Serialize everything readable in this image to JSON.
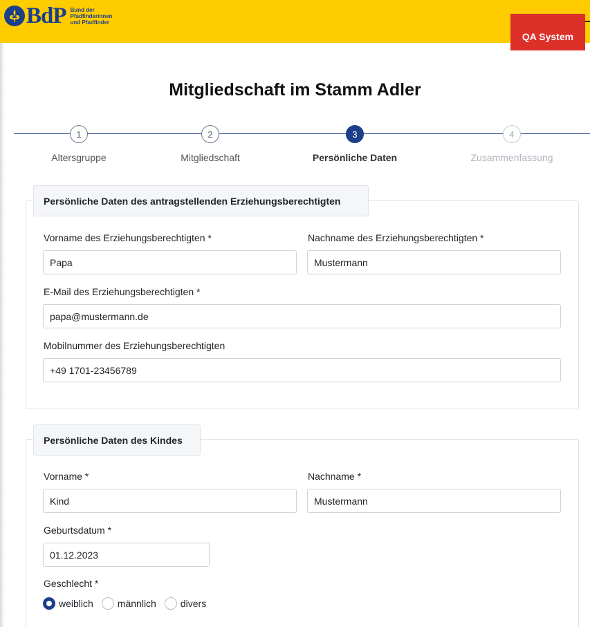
{
  "header": {
    "logo_name": "BdP",
    "logo_sub_lines": [
      "Bund der",
      "Pfadfinderinnen",
      "und Pfadfinder"
    ],
    "badge": "QA System",
    "brand_color": "#ffcc00",
    "accent_color": "#1c3f8a",
    "badge_color": "#dc3028"
  },
  "page": {
    "title": "Mitgliedschaft im Stamm Adler"
  },
  "stepper": {
    "current_step": 3,
    "steps": [
      {
        "number": "1",
        "label": "Altersgruppe",
        "state": "done"
      },
      {
        "number": "2",
        "label": "Mitgliedschaft",
        "state": "done"
      },
      {
        "number": "3",
        "label": "Persönliche Daten",
        "state": "active"
      },
      {
        "number": "4",
        "label": "Zusammenfassung",
        "state": "pending"
      }
    ]
  },
  "guardian": {
    "legend": "Persönliche Daten des antragstellenden Erziehungsberechtigten",
    "firstname_label": "Vorname des Erziehungsberechtigten *",
    "firstname_value": "Papa",
    "lastname_label": "Nachname des Erziehungsberechtigten *",
    "lastname_value": "Mustermann",
    "email_label": "E-Mail des Erziehungsberechtigten *",
    "email_value": "papa@mustermann.de",
    "mobile_label": "Mobilnummer des Erziehungsberechtigten",
    "mobile_value": "+49 1701-23456789"
  },
  "child": {
    "legend": "Persönliche Daten des Kindes",
    "firstname_label": "Vorname *",
    "firstname_value": "Kind",
    "lastname_label": "Nachname *",
    "lastname_value": "Mustermann",
    "birthdate_label": "Geburtsdatum *",
    "birthdate_value": "01.12.2023",
    "gender_label": "Geschlecht *",
    "gender_options": [
      "weiblich",
      "männlich",
      "divers"
    ],
    "gender_selected": "weiblich"
  }
}
